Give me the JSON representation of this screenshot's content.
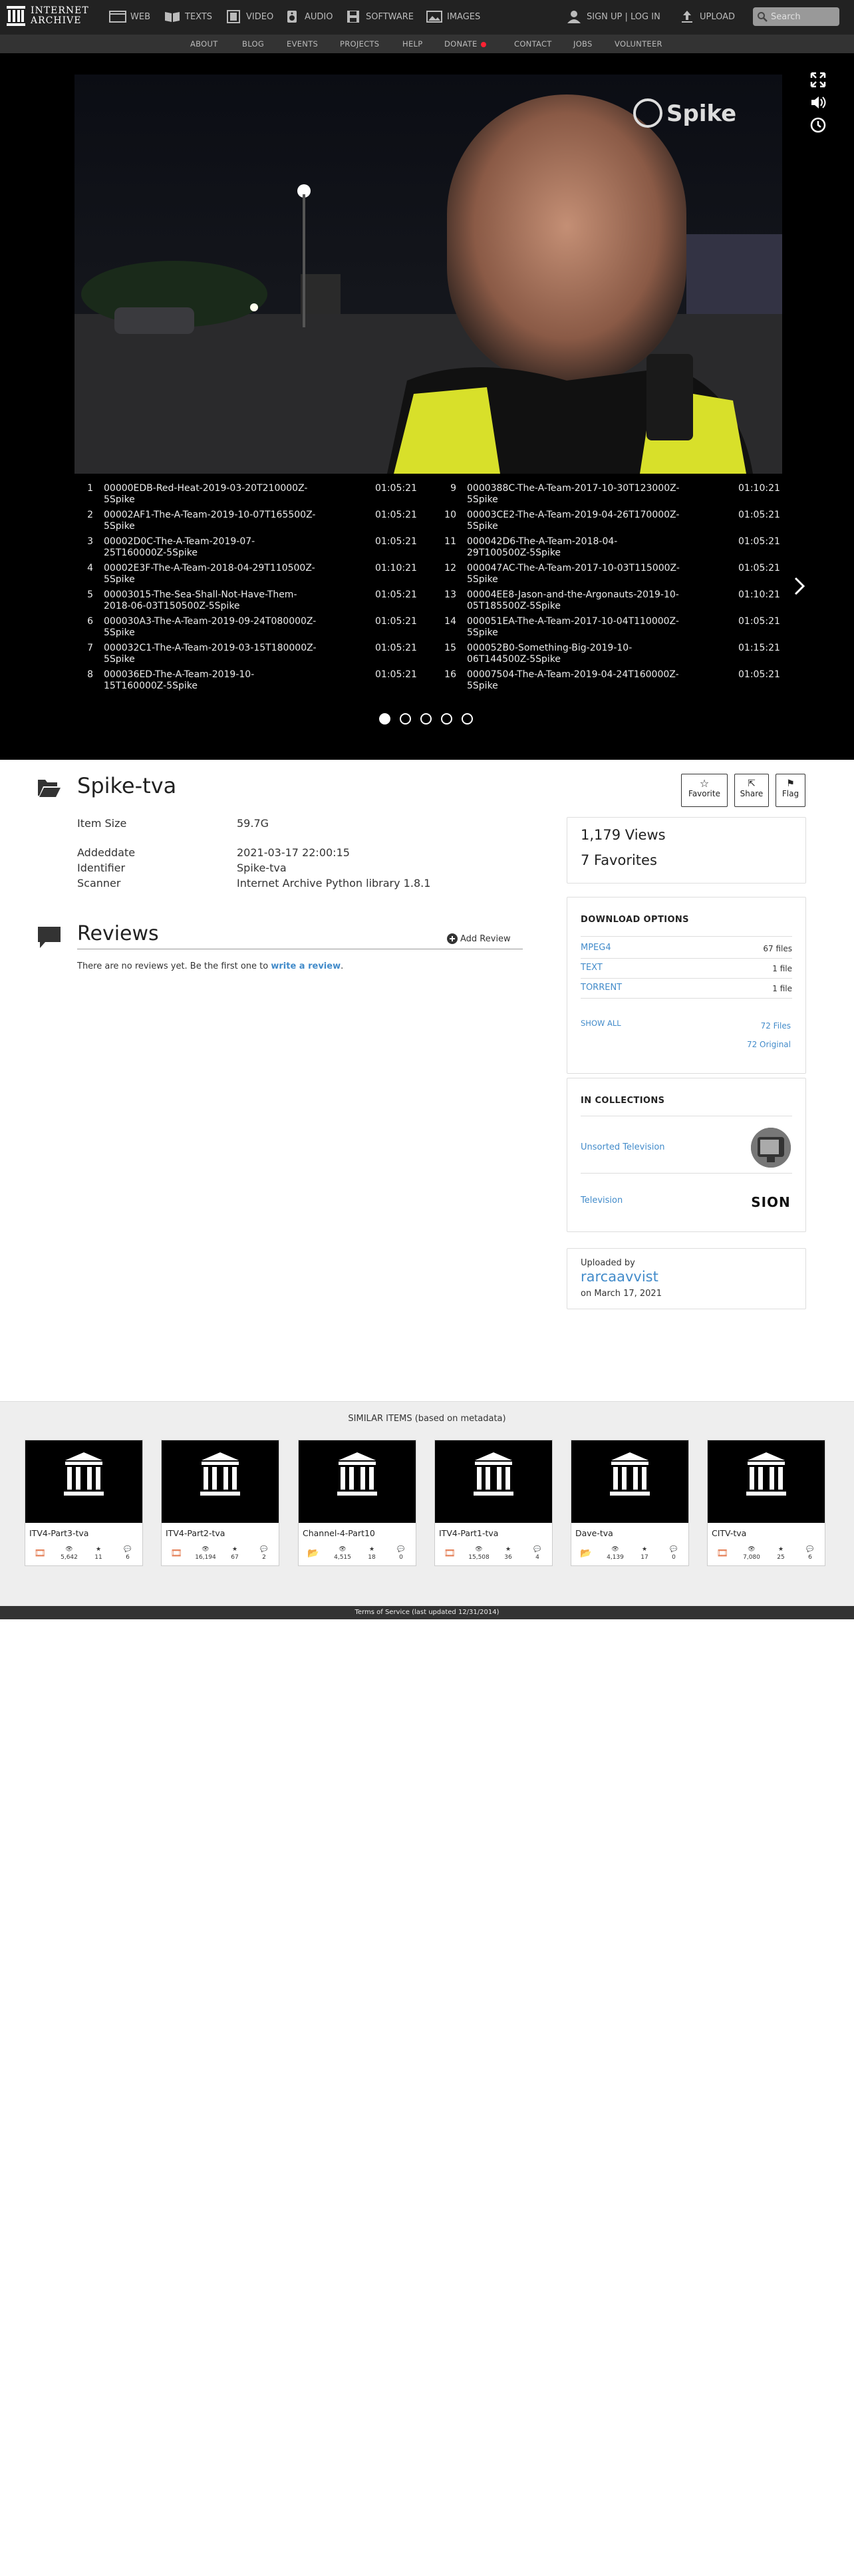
{
  "logo": {
    "line1": "INTERNET",
    "line2": "ARCHIVE"
  },
  "nav": {
    "items": [
      {
        "label": "WEB",
        "icon": "web-icon"
      },
      {
        "label": "TEXTS",
        "icon": "book-icon"
      },
      {
        "label": "VIDEO",
        "icon": "film-icon"
      },
      {
        "label": "AUDIO",
        "icon": "speaker-icon"
      },
      {
        "label": "SOFTWARE",
        "icon": "floppy-icon"
      },
      {
        "label": "IMAGES",
        "icon": "image-icon"
      }
    ],
    "signup": "SIGN UP | LOG IN",
    "upload": "UPLOAD",
    "search_placeholder": "Search"
  },
  "subnav": [
    "ABOUT",
    "BLOG",
    "EVENTS",
    "PROJECTS",
    "HELP",
    "DONATE",
    "CONTACT",
    "JOBS",
    "VOLUNTEER"
  ],
  "video": {
    "watermark": "Spike"
  },
  "playlist": [
    {
      "n": "1",
      "title": "00000EDB-Red-Heat-2019-03-20T210000Z-5Spike",
      "time": "01:05:21"
    },
    {
      "n": "2",
      "title": "00002AF1-The-A-Team-2019-10-07T165500Z-5Spike",
      "time": "01:05:21"
    },
    {
      "n": "3",
      "title": "00002D0C-The-A-Team-2019-07-25T160000Z-5Spike",
      "time": "01:05:21"
    },
    {
      "n": "4",
      "title": "00002E3F-The-A-Team-2018-04-29T110500Z-5Spike",
      "time": "01:10:21"
    },
    {
      "n": "5",
      "title": "00003015-The-Sea-Shall-Not-Have-Them-2018-06-03T150500Z-5Spike",
      "time": "01:05:21"
    },
    {
      "n": "6",
      "title": "000030A3-The-A-Team-2019-09-24T080000Z-5Spike",
      "time": "01:05:21"
    },
    {
      "n": "7",
      "title": "000032C1-The-A-Team-2019-03-15T180000Z-5Spike",
      "time": "01:05:21"
    },
    {
      "n": "8",
      "title": "000036ED-The-A-Team-2019-10-15T160000Z-5Spike",
      "time": "01:05:21"
    },
    {
      "n": "9",
      "title": "0000388C-The-A-Team-2017-10-30T123000Z-5Spike",
      "time": "01:10:21"
    },
    {
      "n": "10",
      "title": "00003CE2-The-A-Team-2019-04-26T170000Z-5Spike",
      "time": "01:05:21"
    },
    {
      "n": "11",
      "title": "000042D6-The-A-Team-2018-04-29T100500Z-5Spike",
      "time": "01:05:21"
    },
    {
      "n": "12",
      "title": "000047AC-The-A-Team-2017-10-03T115000Z-5Spike",
      "time": "01:05:21"
    },
    {
      "n": "13",
      "title": "00004EE8-Jason-and-the-Argonauts-2019-10-05T185500Z-5Spike",
      "time": "01:10:21"
    },
    {
      "n": "14",
      "title": "000051EA-The-A-Team-2017-10-04T110000Z-5Spike",
      "time": "01:05:21"
    },
    {
      "n": "15",
      "title": "000052B0-Something-Big-2019-10-06T144500Z-5Spike",
      "time": "01:15:21"
    },
    {
      "n": "16",
      "title": "00007504-The-A-Team-2019-04-24T160000Z-5Spike",
      "time": "01:05:21"
    }
  ],
  "item": {
    "title": "Spike-tva",
    "buttons": {
      "favorite": "Favorite",
      "share": "Share",
      "flag": "Flag"
    },
    "metadata": [
      {
        "label": "Item Size",
        "value": "59.7G"
      },
      {
        "label": "Addeddate",
        "value": "2021-03-17 22:00:15"
      },
      {
        "label": "Identifier",
        "value": "Spike-tva"
      },
      {
        "label": "Scanner",
        "value": "Internet Archive Python library 1.8.1"
      }
    ]
  },
  "reviews": {
    "heading": "Reviews",
    "add": "Add Review",
    "empty_prefix": "There are no reviews yet. Be the first one to",
    "empty_link": "write a review",
    "empty_suffix": "."
  },
  "stats": {
    "views": "1,179 Views",
    "favorites": "7 Favorites"
  },
  "downloads": {
    "heading": "DOWNLOAD OPTIONS",
    "rows": [
      {
        "label": "MPEG4",
        "count": "67 files"
      },
      {
        "label": "TEXT",
        "count": "1 file"
      },
      {
        "label": "TORRENT",
        "count": "1 file"
      }
    ],
    "show_all": "SHOW ALL",
    "files": "72 Files",
    "original": "72 Original"
  },
  "collections": {
    "heading": "IN COLLECTIONS",
    "items": [
      {
        "label": "Unsorted Television"
      },
      {
        "label": "Television",
        "thumb_text": "SION"
      }
    ]
  },
  "uploader": {
    "label": "Uploaded by",
    "name": "rarcaavvist",
    "date": "on March 17, 2021"
  },
  "similar": {
    "heading": "SIMILAR ITEMS (based on metadata)",
    "items": [
      {
        "title": "ITV4-Part3-tva",
        "type": "film-icon",
        "views": "5,642",
        "favs": "11",
        "reviews": "6"
      },
      {
        "title": "ITV4-Part2-tva",
        "type": "film-icon",
        "views": "16,194",
        "favs": "67",
        "reviews": "2"
      },
      {
        "title": "Channel-4-Part10",
        "type": "folder-icon",
        "views": "4,515",
        "favs": "18",
        "reviews": "0"
      },
      {
        "title": "ITV4-Part1-tva",
        "type": "film-icon",
        "views": "15,508",
        "favs": "36",
        "reviews": "4"
      },
      {
        "title": "Dave-tva",
        "type": "folder-icon",
        "views": "4,139",
        "favs": "17",
        "reviews": "0"
      },
      {
        "title": "CITV-tva",
        "type": "film-icon",
        "views": "7,080",
        "favs": "25",
        "reviews": "6"
      }
    ]
  },
  "footer": "Terms of Service (last updated 12/31/2014)",
  "colors": {
    "link": "#428bca",
    "topbar": "#222222",
    "donate_dot": "#ff2233",
    "similar_bg": "#eeeeee"
  }
}
